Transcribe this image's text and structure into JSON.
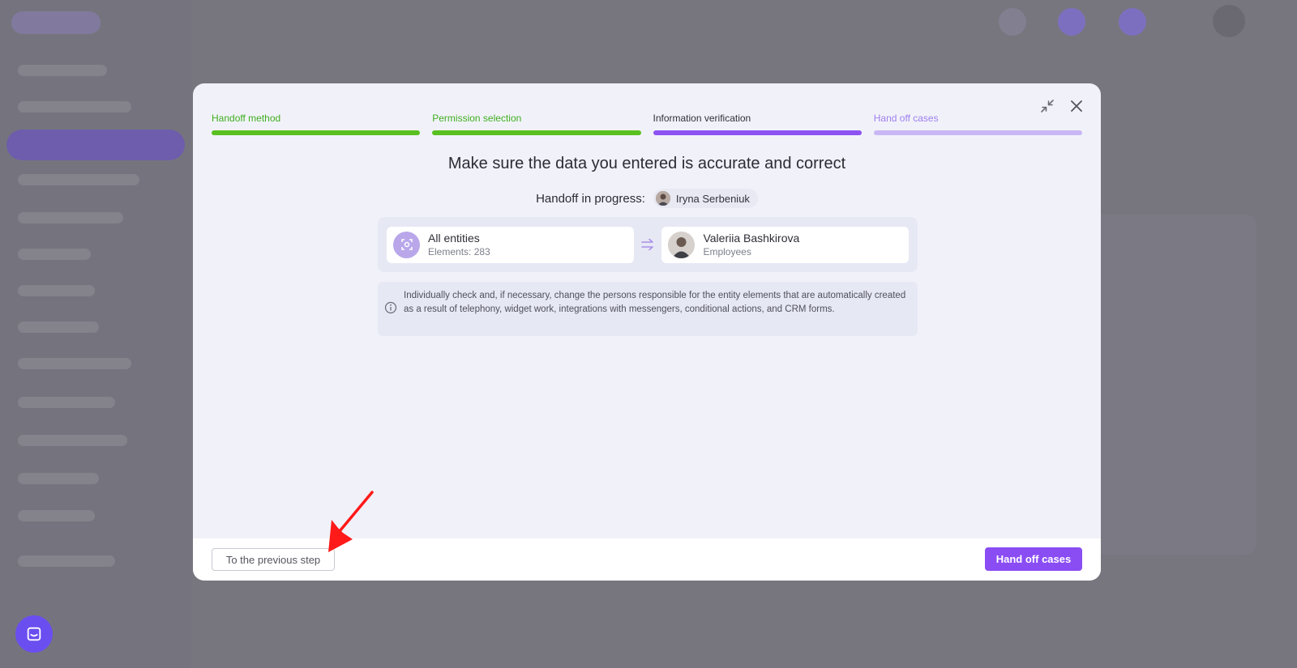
{
  "modal": {
    "steps": [
      {
        "label": "Handoff method",
        "state": "done"
      },
      {
        "label": "Permission selection",
        "state": "done"
      },
      {
        "label": "Information verification",
        "state": "current"
      },
      {
        "label": "Hand off cases",
        "state": "next"
      }
    ],
    "icons": {
      "minimize": "collapse-icon",
      "close": "close-icon"
    },
    "title": "Make sure the data you entered is accurate and correct",
    "progress": {
      "label": "Handoff in progress:",
      "user": "Iryna Serbeniuk"
    },
    "transfer": {
      "from": {
        "name": "All entities",
        "sub": "Elements: 283",
        "icon": "entities-icon"
      },
      "arrow_icon": "transfer-arrow-icon",
      "to": {
        "name": "Valeriia Bashkirova",
        "sub": "Employees"
      }
    },
    "info": {
      "icon": "info-icon",
      "text": "Individually check and, if necessary, change the persons responsible for the entity elements that are automatically created as a result of telephony, widget work, integrations with messengers, conditional actions, and CRM forms."
    },
    "footer": {
      "prev_label": "To the previous step",
      "primary_label": "Hand off cases"
    }
  },
  "colors": {
    "done": "#59c022",
    "current": "#8d52f2",
    "next": "#c9b7f5",
    "primary": "#8a4cf3",
    "annotation": "#ff1a1a"
  },
  "chat_launcher": {
    "icon": "chat-icon"
  }
}
